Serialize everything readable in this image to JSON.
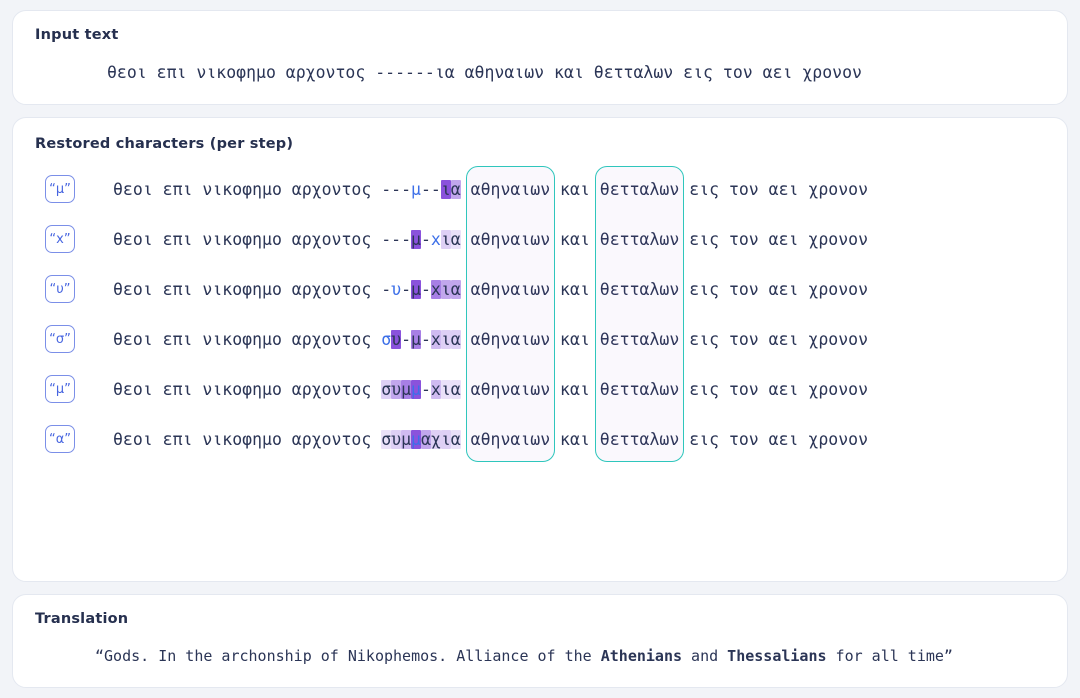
{
  "input": {
    "title": "Input text",
    "text": "θεοι επι νικοφημο αρχοντος ------ια αθηναιων και θετταλων εις τον αει χρονον"
  },
  "steps": {
    "title": "Restored characters (per step)",
    "prefix": "θεοι επι νικοφημο αρχοντος ",
    "suffix_mid": " αθηναιων και θετταλων ",
    "suffix_tail": "εις τον αει χρονον",
    "focus_words": [
      "αθηναιων",
      "θετταλων"
    ],
    "rows": [
      {
        "badge": "“μ”",
        "predicted_char": "μ",
        "gap": "---μ--ια",
        "cells": [
          {
            "ch": "-",
            "level": 0,
            "blue": false
          },
          {
            "ch": "-",
            "level": 0,
            "blue": false
          },
          {
            "ch": "-",
            "level": 0,
            "blue": false
          },
          {
            "ch": "μ",
            "level": 0,
            "blue": true
          },
          {
            "ch": "-",
            "level": 0,
            "blue": false
          },
          {
            "ch": "-",
            "level": 0,
            "blue": false
          },
          {
            "ch": "ι",
            "level": 7,
            "blue": false
          },
          {
            "ch": "α",
            "level": 5,
            "blue": false
          }
        ]
      },
      {
        "badge": "“x”",
        "predicted_char": "x",
        "gap": "---μ-xια",
        "cells": [
          {
            "ch": "-",
            "level": 0,
            "blue": false
          },
          {
            "ch": "-",
            "level": 0,
            "blue": false
          },
          {
            "ch": "-",
            "level": 0,
            "blue": false
          },
          {
            "ch": "μ",
            "level": 7,
            "blue": false
          },
          {
            "ch": "-",
            "level": 0,
            "blue": false
          },
          {
            "ch": "x",
            "level": 0,
            "blue": true
          },
          {
            "ch": "ι",
            "level": 3,
            "blue": false
          },
          {
            "ch": "α",
            "level": 2,
            "blue": false
          }
        ]
      },
      {
        "badge": "“υ”",
        "predicted_char": "υ",
        "gap": "-υ-μ-xια",
        "cells": [
          {
            "ch": "-",
            "level": 0,
            "blue": false
          },
          {
            "ch": "υ",
            "level": 0,
            "blue": true
          },
          {
            "ch": "-",
            "level": 0,
            "blue": false
          },
          {
            "ch": "μ",
            "level": 7,
            "blue": false
          },
          {
            "ch": "-",
            "level": 0,
            "blue": false
          },
          {
            "ch": "x",
            "level": 6,
            "blue": false
          },
          {
            "ch": "ι",
            "level": 5,
            "blue": false
          },
          {
            "ch": "α",
            "level": 5,
            "blue": false
          }
        ]
      },
      {
        "badge": "“σ”",
        "predicted_char": "σ",
        "gap": "συ-μ-xια",
        "cells": [
          {
            "ch": "σ",
            "level": 0,
            "blue": true
          },
          {
            "ch": "υ",
            "level": 7,
            "blue": false
          },
          {
            "ch": "-",
            "level": 0,
            "blue": false
          },
          {
            "ch": "μ",
            "level": 6,
            "blue": false
          },
          {
            "ch": "-",
            "level": 0,
            "blue": false
          },
          {
            "ch": "x",
            "level": 4,
            "blue": false
          },
          {
            "ch": "ι",
            "level": 3,
            "blue": false
          },
          {
            "ch": "α",
            "level": 3,
            "blue": false
          }
        ]
      },
      {
        "badge": "“μ”",
        "predicted_char": "μ",
        "gap": "συμμ-xια",
        "cells": [
          {
            "ch": "σ",
            "level": 3,
            "blue": false
          },
          {
            "ch": "υ",
            "level": 5,
            "blue": false
          },
          {
            "ch": "μ",
            "level": 6,
            "blue": false
          },
          {
            "ch": "μ",
            "level": 7,
            "blue": true
          },
          {
            "ch": "-",
            "level": 0,
            "blue": false
          },
          {
            "ch": "x",
            "level": 4,
            "blue": false
          },
          {
            "ch": "ι",
            "level": 2,
            "blue": false
          },
          {
            "ch": "α",
            "level": 2,
            "blue": false
          }
        ]
      },
      {
        "badge": "“α”",
        "predicted_char": "α",
        "gap": "συμμαχια",
        "cells": [
          {
            "ch": "σ",
            "level": 2,
            "blue": false
          },
          {
            "ch": "υ",
            "level": 3,
            "blue": false
          },
          {
            "ch": "μ",
            "level": 4,
            "blue": false
          },
          {
            "ch": "μ",
            "level": 7,
            "blue": true
          },
          {
            "ch": "α",
            "level": 5,
            "blue": false
          },
          {
            "ch": "χ",
            "level": 3,
            "blue": false
          },
          {
            "ch": "ι",
            "level": 3,
            "blue": false
          },
          {
            "ch": "α",
            "level": 2,
            "blue": false
          }
        ]
      }
    ]
  },
  "translation": {
    "title": "Translation",
    "open_quote": "“",
    "part1": "Gods. In the archonship of Nikophemos. Alliance of the ",
    "bold1": "Athenians",
    "part2": " and ",
    "bold2": "Thessalians",
    "part3": " for all time",
    "close_quote": "”"
  },
  "colors": {
    "page_background": "#f2f4f8",
    "card_background": "#ffffff",
    "card_border": "#e4e8f0",
    "text": "#2b3556",
    "accent_blue": "#3c6fe8",
    "badge_border": "#7b8fe8",
    "highlight_purple": "#7e42d8",
    "focus_teal": "#2fc6bc"
  }
}
